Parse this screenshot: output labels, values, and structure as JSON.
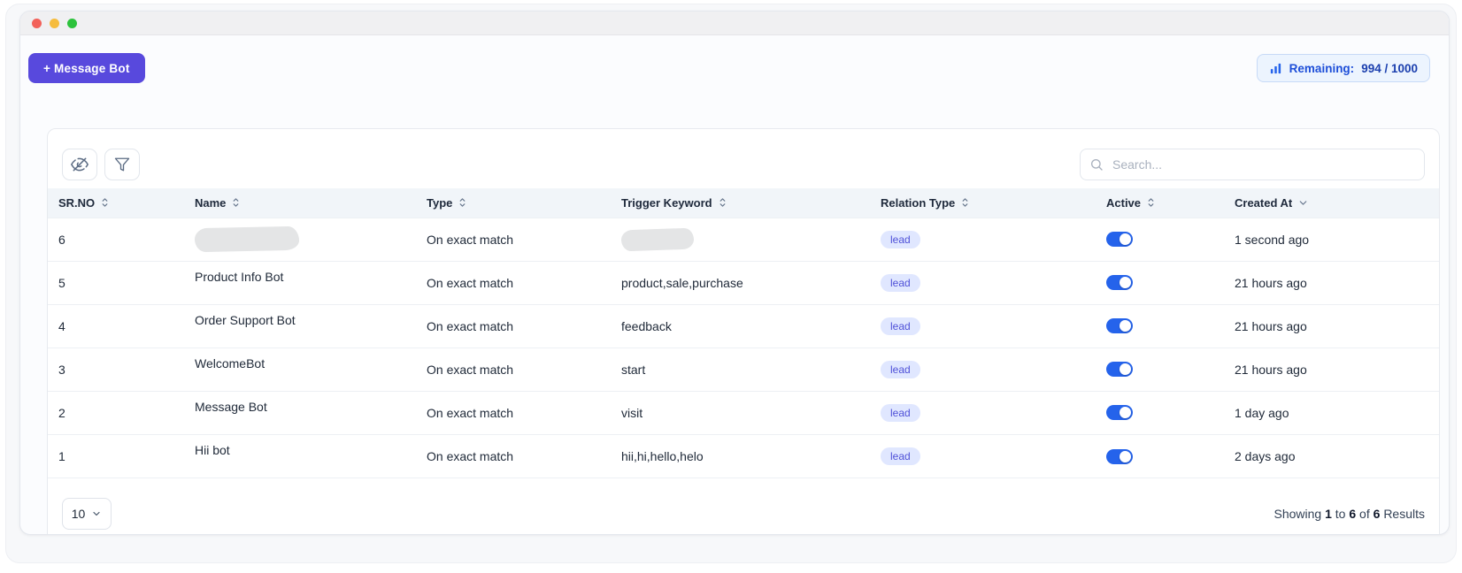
{
  "window": {
    "titlebar_buttons": [
      "close",
      "minimize",
      "zoom"
    ]
  },
  "toolbar": {
    "add_button_label": "+ Message Bot",
    "remaining_label": "Remaining:",
    "remaining_value": "994 / 1000"
  },
  "search": {
    "placeholder": "Search..."
  },
  "table": {
    "columns": [
      {
        "label": "SR.NO",
        "sort": "both"
      },
      {
        "label": "Name",
        "sort": "both"
      },
      {
        "label": "Type",
        "sort": "both"
      },
      {
        "label": "Trigger Keyword",
        "sort": "both"
      },
      {
        "label": "Relation Type",
        "sort": "both"
      },
      {
        "label": "Active",
        "sort": "both"
      },
      {
        "label": "Created At",
        "sort": "desc"
      }
    ],
    "rows": [
      {
        "sr_no": "6",
        "name": "",
        "name_redacted": true,
        "type": "On exact match",
        "trigger_keyword": "",
        "trigger_redacted": true,
        "relation_type": "lead",
        "active": true,
        "created_at": "1 second ago"
      },
      {
        "sr_no": "5",
        "name": "Product Info Bot",
        "type": "On exact match",
        "trigger_keyword": "product,sale,purchase",
        "relation_type": "lead",
        "active": true,
        "created_at": "21 hours ago"
      },
      {
        "sr_no": "4",
        "name": "Order Support Bot",
        "type": "On exact match",
        "trigger_keyword": "feedback",
        "relation_type": "lead",
        "active": true,
        "created_at": "21 hours ago"
      },
      {
        "sr_no": "3",
        "name": "WelcomeBot",
        "type": "On exact match",
        "trigger_keyword": "start",
        "relation_type": "lead",
        "active": true,
        "created_at": "21 hours ago"
      },
      {
        "sr_no": "2",
        "name": "Message Bot",
        "type": "On exact match",
        "trigger_keyword": "visit",
        "relation_type": "lead",
        "active": true,
        "created_at": "1 day ago"
      },
      {
        "sr_no": "1",
        "name": "Hii bot",
        "type": "On exact match",
        "trigger_keyword": "hii,hi,hello,helo",
        "relation_type": "lead",
        "active": true,
        "created_at": "2 days ago"
      }
    ]
  },
  "pagination": {
    "page_size": "10",
    "showing_word": "Showing",
    "from": "1",
    "to_word": "to",
    "to": "6",
    "of_word": "of",
    "total": "6",
    "results_word": "Results"
  },
  "icons": {
    "bar_chart_icon": "ascending-bars",
    "eye_off_icon": "hide-columns",
    "filter_icon": "funnel",
    "search_icon": "magnifier",
    "sort_icon": "up-down-chevrons",
    "chevron_down_icon": "chevron-down"
  },
  "colors": {
    "accent_button": "#5849dd",
    "toggle_on": "#2563eb",
    "badge_bg": "#e0e7ff",
    "badge_text": "#4f51d8",
    "remaining_text": "#1d4ed8",
    "remaining_bg": "#ecf4fe",
    "header_bg": "#f1f5f9"
  }
}
